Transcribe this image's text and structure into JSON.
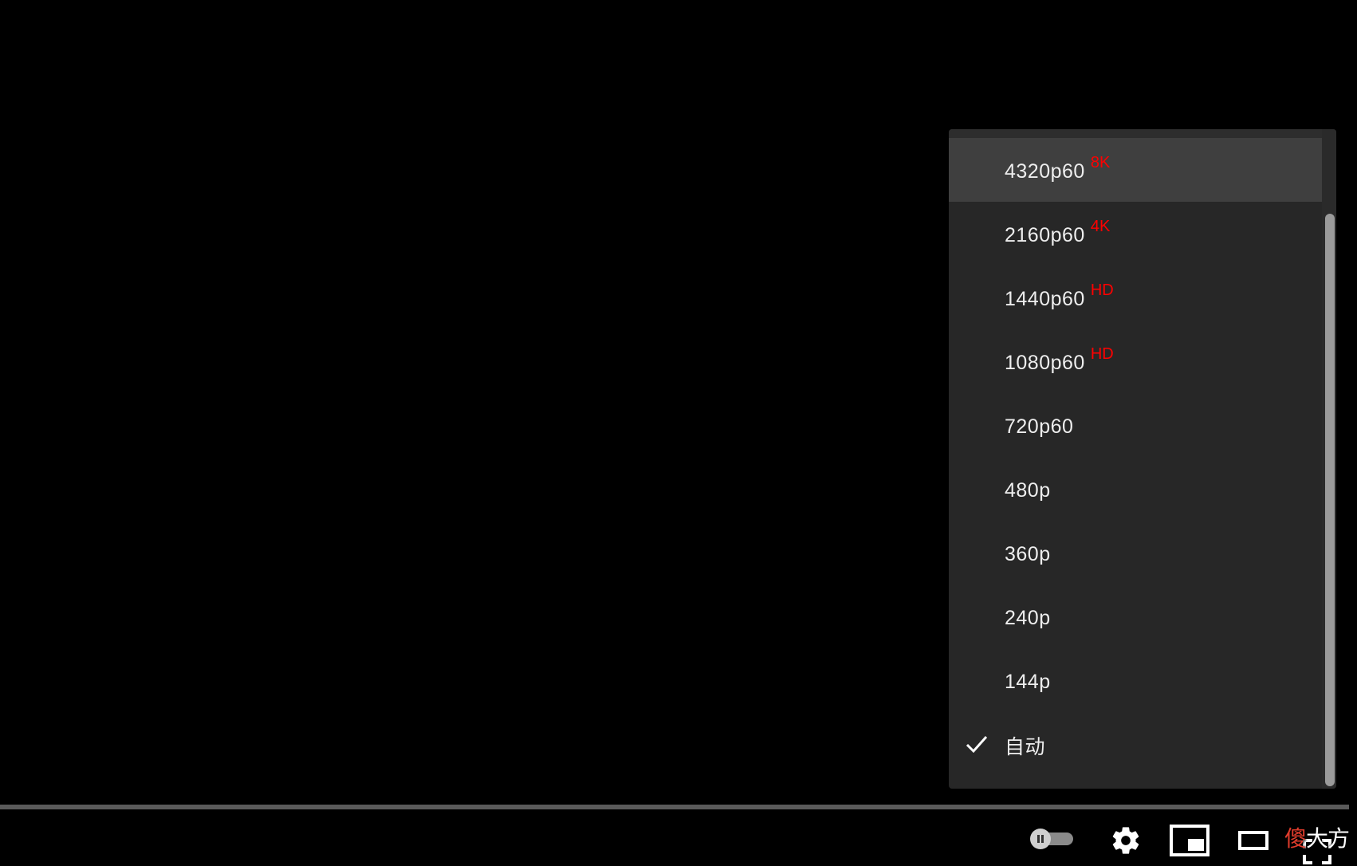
{
  "quality_menu": {
    "items": [
      {
        "label": "4320p60",
        "badge": "8K",
        "selected": false
      },
      {
        "label": "2160p60",
        "badge": "4K",
        "selected": false
      },
      {
        "label": "1440p60",
        "badge": "HD",
        "selected": false
      },
      {
        "label": "1080p60",
        "badge": "HD",
        "selected": false
      },
      {
        "label": "720p60",
        "badge": "",
        "selected": false
      },
      {
        "label": "480p",
        "badge": "",
        "selected": false
      },
      {
        "label": "360p",
        "badge": "",
        "selected": false
      },
      {
        "label": "240p",
        "badge": "",
        "selected": false
      },
      {
        "label": "144p",
        "badge": "",
        "selected": false
      },
      {
        "label": "自动",
        "badge": "",
        "selected": true
      }
    ],
    "highlighted_index": 0,
    "badge_color": "#ff0000"
  },
  "controls": {
    "icons": [
      "autoplay-toggle-icon",
      "gear-icon",
      "miniplayer-icon",
      "theater-mode-icon",
      "fullscreen-icon"
    ]
  },
  "watermark": {
    "first_char": "傻",
    "rest": "大方"
  }
}
